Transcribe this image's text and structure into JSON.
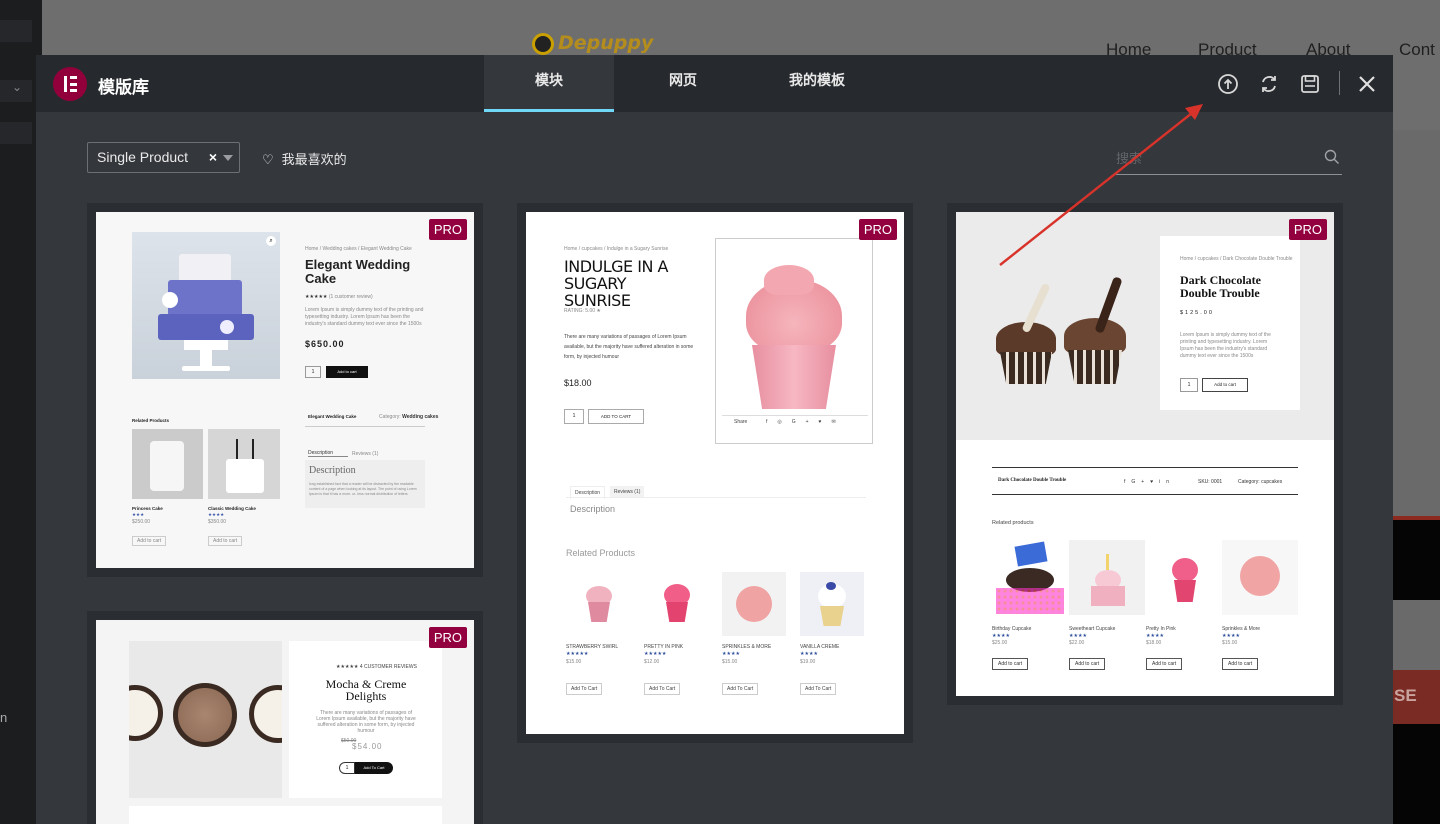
{
  "background_site": {
    "logo_text": "Depuppy",
    "nav": [
      "Home",
      "Product",
      "About",
      "Cont"
    ],
    "right_fragment": "SE",
    "left_fragment": "n"
  },
  "modal": {
    "title": "模版库",
    "tabs": [
      {
        "label": "模块",
        "active": true
      },
      {
        "label": "网页",
        "active": false
      },
      {
        "label": "我的模板",
        "active": false
      }
    ],
    "header_icons": [
      "upload-icon",
      "sync-icon",
      "save-icon",
      "close-icon"
    ]
  },
  "toolbar": {
    "filter_value": "Single Product",
    "clear_symbol": "×",
    "favorites_label": "我最喜欢的",
    "search_placeholder": "搜索"
  },
  "cards": [
    {
      "badge": "PRO",
      "breadcrumb": "Home / Wedding cakes / Elegant Wedding Cake",
      "title": "Elegant Wedding Cake",
      "reviews": "(1 customer review)",
      "desc": "Lorem Ipsum is simply dummy text of the printing and typesetting industry. Lorem Ipsum has been the industry's standard dummy text ever since the 1500s",
      "price": "$650.00",
      "qty": "1",
      "cta": "Add to cart",
      "related_heading": "Related Products",
      "meta_name": "Elegant Wedding Cake",
      "meta_cat_label": "Category:",
      "meta_cat": "Wedding cakes",
      "tab_desc": "Description",
      "tab_reviews": "Reviews (1)",
      "desc_heading": "Description",
      "desc_body": "long established fact that a reader will be distracted by the readable content of a page when looking at its layout. The point of using Lorem Ipsum is that it has a more- or- less normal distribution of letters",
      "related": [
        {
          "name": "Princess Cake",
          "price": "$250.00",
          "cta": "Add to cart"
        },
        {
          "name": "Classic Wedding Cake",
          "price": "$350.00",
          "cta": "Add to cart"
        }
      ]
    },
    {
      "badge": "PRO",
      "breadcrumb": "Home / cupcakes / Indulge in a Sugary Sunrise",
      "title": "INDULGE IN A SUGARY SUNRISE",
      "rating": "RATING: 5.00",
      "desc": "There are many variations of passages of Lorem Ipsum available, but the majority have suffered alteration in some form, by injected humour",
      "price": "$18.00",
      "qty": "1",
      "cta": "ADD TO CART",
      "share": "Share",
      "tab_desc": "Description",
      "tab_reviews": "Reviews (1)",
      "desc_heading": "Description",
      "related_heading": "Related Products",
      "related": [
        {
          "name": "STRAWBERRY SWIRL",
          "price": "$15.00",
          "cta": "Add To Cart"
        },
        {
          "name": "PRETTY IN PINK",
          "price": "$12.00",
          "cta": "Add To Cart"
        },
        {
          "name": "SPRINKLES & MORE",
          "price": "$15.00",
          "cta": "Add To Cart"
        },
        {
          "name": "VANILLA CREME",
          "price": "$19.00",
          "cta": "Add To Cart"
        }
      ]
    },
    {
      "badge": "PRO",
      "breadcrumb": "Home / cupcakes / Dark Chocolate Double Trouble",
      "title": "Dark Chocolate Double Trouble",
      "price": "$125.00",
      "desc": "Lorem Ipsum is simply dummy text of the printing and typesetting industry. Lorem Ipsum has been the industry's standard dummy text ever since the 1500s",
      "qty": "1",
      "cta": "Add to cart",
      "meta_name": "Dark Chocolate Double Trouble",
      "sku": "SKU: 0001",
      "category": "Category: cupcakes",
      "related_heading": "Related products",
      "related": [
        {
          "name": "Birthday Cupcake",
          "price": "$25.00",
          "cta": "Add to cart"
        },
        {
          "name": "Sweetheart Cupcake",
          "price": "$22.00",
          "cta": "Add to cart"
        },
        {
          "name": "Pretty In Pink",
          "price": "$18.00",
          "cta": "Add to cart"
        },
        {
          "name": "Sprinkles & More",
          "price": "$15.00",
          "cta": "Add to cart"
        }
      ]
    },
    {
      "badge": "PRO",
      "subtitle": "4 CUSTOMER REVIEWS",
      "title": "Mocha & Creme Delights",
      "desc": "There are many variations of passages of Lorem Ipsum available, but the majority have suffered alteration in some form, by injected humour",
      "old_price": "$50.00",
      "price": "$54.00",
      "qty": "1",
      "cta": "Add To Cart"
    }
  ]
}
